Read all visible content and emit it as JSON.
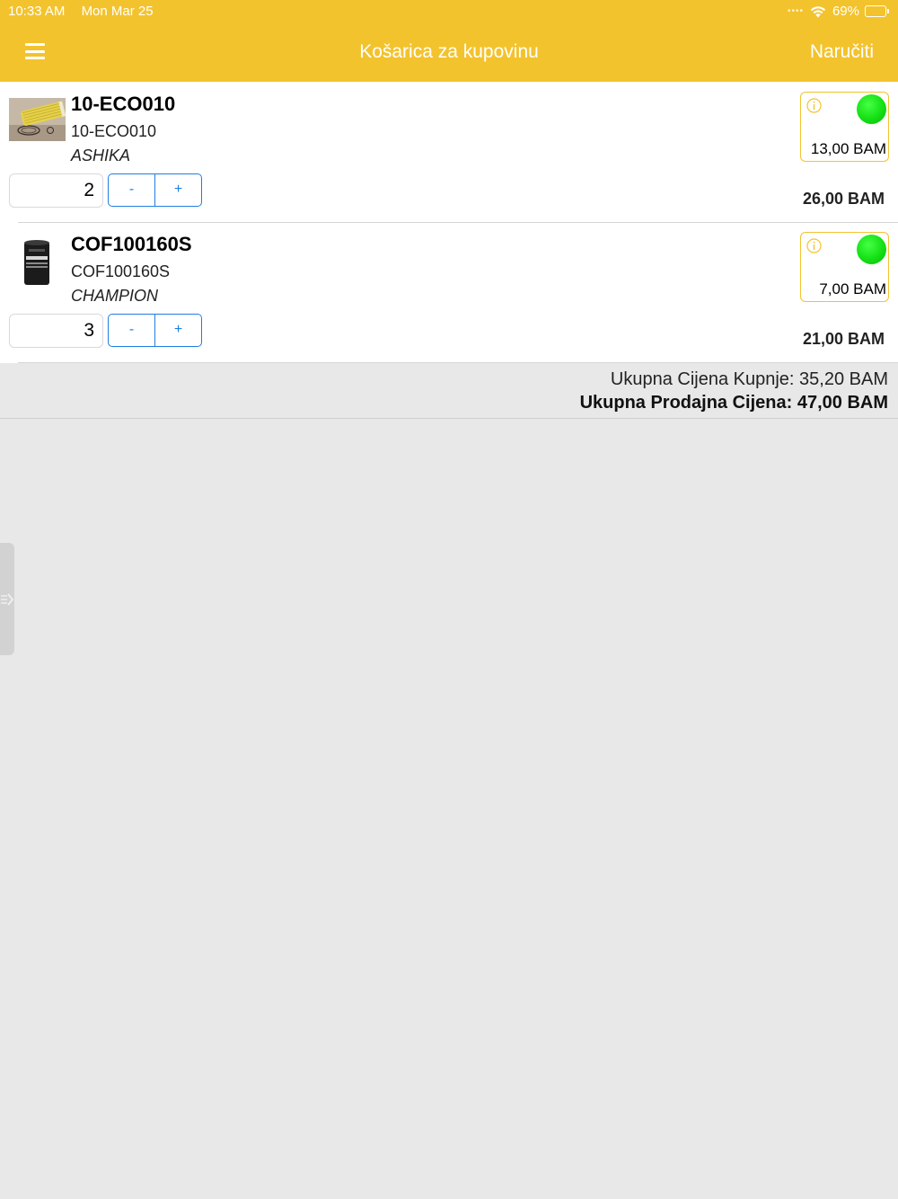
{
  "status_bar": {
    "time": "10:33 AM",
    "date": "Mon Mar 25",
    "battery": "69%",
    "battery_level": 0.69
  },
  "header": {
    "title": "Košarica za kupovinu",
    "order_label": "Naručiti",
    "background_color": "#f3c32d"
  },
  "cart": {
    "items": [
      {
        "name": "10-ECO010",
        "code": "10-ECO010",
        "brand": "ASHIKA",
        "quantity": "2",
        "minus_label": "-",
        "plus_label": "+",
        "unit_price": "13,00 BAM",
        "total": "26,00 BAM",
        "stock_status_color": "#14e014"
      },
      {
        "name": "COF100160S",
        "code": "COF100160S",
        "brand": "CHAMPION",
        "quantity": "3",
        "minus_label": "-",
        "plus_label": "+",
        "unit_price": "7,00 BAM",
        "total": "21,00 BAM",
        "stock_status_color": "#14e014"
      }
    ]
  },
  "totals": {
    "purchase_label": "Ukupna Cijena Kupnje:",
    "purchase_value": "35,20 BAM",
    "sale_label": "Ukupna Prodajna Cijena:",
    "sale_value": "47,00 BAM"
  }
}
